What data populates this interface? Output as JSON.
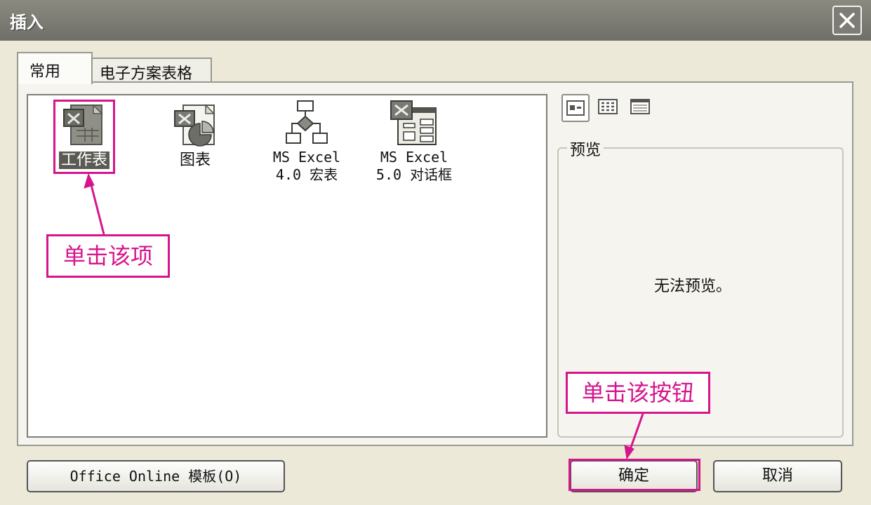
{
  "dialog": {
    "title": "插入",
    "tabs": [
      {
        "label": "常用"
      },
      {
        "label": "电子方案表格"
      }
    ],
    "items": [
      {
        "icon": "worksheet-icon",
        "label": "工作表"
      },
      {
        "icon": "chart-icon",
        "label": "图表"
      },
      {
        "icon": "macro-sheet-icon",
        "line1": "MS Excel",
        "line2": "4.0 宏表"
      },
      {
        "icon": "dialog-sheet-icon",
        "line1": "MS Excel",
        "line2": "5.0 对话框"
      }
    ],
    "preview": {
      "legend": "预览",
      "message": "无法预览。"
    },
    "buttons": {
      "office_online": "Office Online 模板(O)",
      "ok": "确定",
      "cancel": "取消"
    },
    "view_icons": [
      "large-icons-view-icon",
      "list-view-icon",
      "details-view-icon"
    ]
  },
  "annotations": {
    "callout_item": "单击该项",
    "callout_button": "单击该按钮",
    "highlight_color": "#d6158c"
  }
}
